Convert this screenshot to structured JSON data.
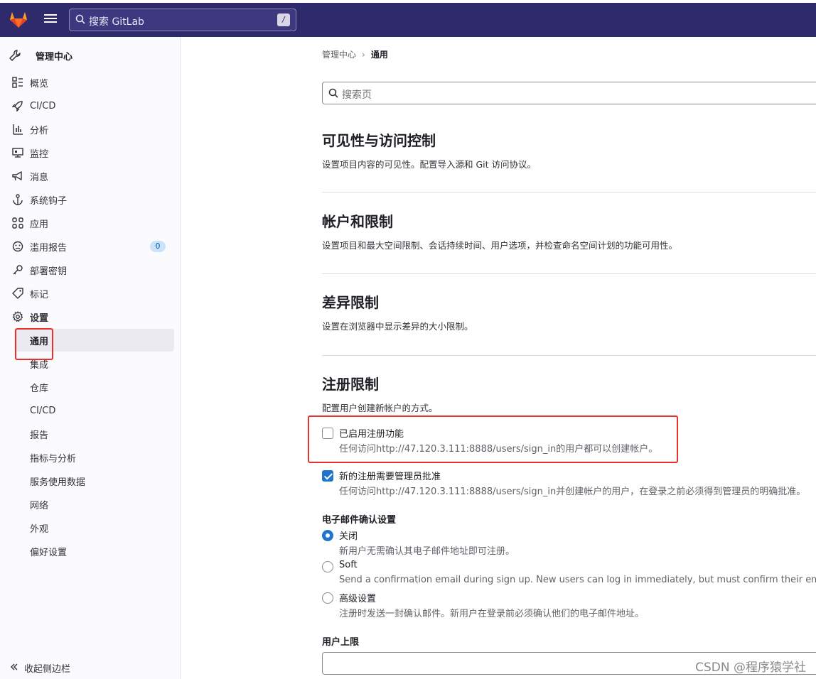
{
  "topbar": {
    "search_placeholder": "搜索 GitLab",
    "search_shortcut": "/"
  },
  "sidebar": {
    "header": "管理中心",
    "items": [
      {
        "label": "概览",
        "icon": "overview-icon"
      },
      {
        "label": "CI/CD",
        "icon": "rocket-icon"
      },
      {
        "label": "分析",
        "icon": "chart-icon"
      },
      {
        "label": "监控",
        "icon": "monitor-icon"
      },
      {
        "label": "消息",
        "icon": "bullhorn-icon"
      },
      {
        "label": "系统钩子",
        "icon": "anchor-icon"
      },
      {
        "label": "应用",
        "icon": "applications-icon"
      },
      {
        "label": "滥用报告",
        "icon": "sad-face-icon",
        "badge": "0"
      },
      {
        "label": "部署密钥",
        "icon": "key-icon"
      },
      {
        "label": "标记",
        "icon": "label-icon"
      },
      {
        "label": "设置",
        "icon": "gear-icon"
      }
    ],
    "settings_sub": [
      "通用",
      "集成",
      "仓库",
      "CI/CD",
      "报告",
      "指标与分析",
      "服务使用数据",
      "网络",
      "外观",
      "偏好设置"
    ],
    "collapse": "收起侧边栏"
  },
  "main": {
    "breadcrumb": {
      "parent": "管理中心",
      "current": "通用"
    },
    "search_placeholder": "搜索页",
    "sections": [
      {
        "title": "可见性与访问控制",
        "desc": "设置项目内容的可见性。配置导入源和 Git 访问协议。"
      },
      {
        "title": "帐户和限制",
        "desc": "设置项目和最大空间限制、会话持续时间、用户选项，并检查命名空间计划的功能可用性。"
      },
      {
        "title": "差异限制",
        "desc": "设置在浏览器中显示差异的大小限制。"
      },
      {
        "title": "注册限制",
        "desc": "配置用户创建新帐户的方式。"
      }
    ],
    "signup_enabled": {
      "label": "已启用注册功能",
      "help": "任何访问http://47.120.3.111:8888/users/sign_in的用户都可以创建帐户。",
      "checked": false
    },
    "admin_approval": {
      "label": "新的注册需要管理员批准",
      "help": "任何访问http://47.120.3.111:8888/users/sign_in并创建帐户的用户，在登录之前必须得到管理员的明确批准。",
      "checked": true
    },
    "email_confirm": {
      "title": "电子邮件确认设置",
      "options": [
        {
          "label": "关闭",
          "help": "新用户无需确认其电子邮件地址即可注册。",
          "checked": true
        },
        {
          "label": "Soft",
          "help": "Send a confirmation email during sign up. New users can log in immediately, but must confirm their email",
          "checked": false
        },
        {
          "label": "高级设置",
          "help": "注册时发送一封确认邮件。新用户在登录前必须确认他们的电子邮件地址。",
          "checked": false
        }
      ]
    },
    "user_cap": {
      "label": "用户上限",
      "value": ""
    }
  },
  "watermark": "CSDN @程序猿学社",
  "colors": {
    "topbar": "#2f2a6b",
    "accent": "#1f75cb",
    "highlight_box": "#e5322b"
  }
}
